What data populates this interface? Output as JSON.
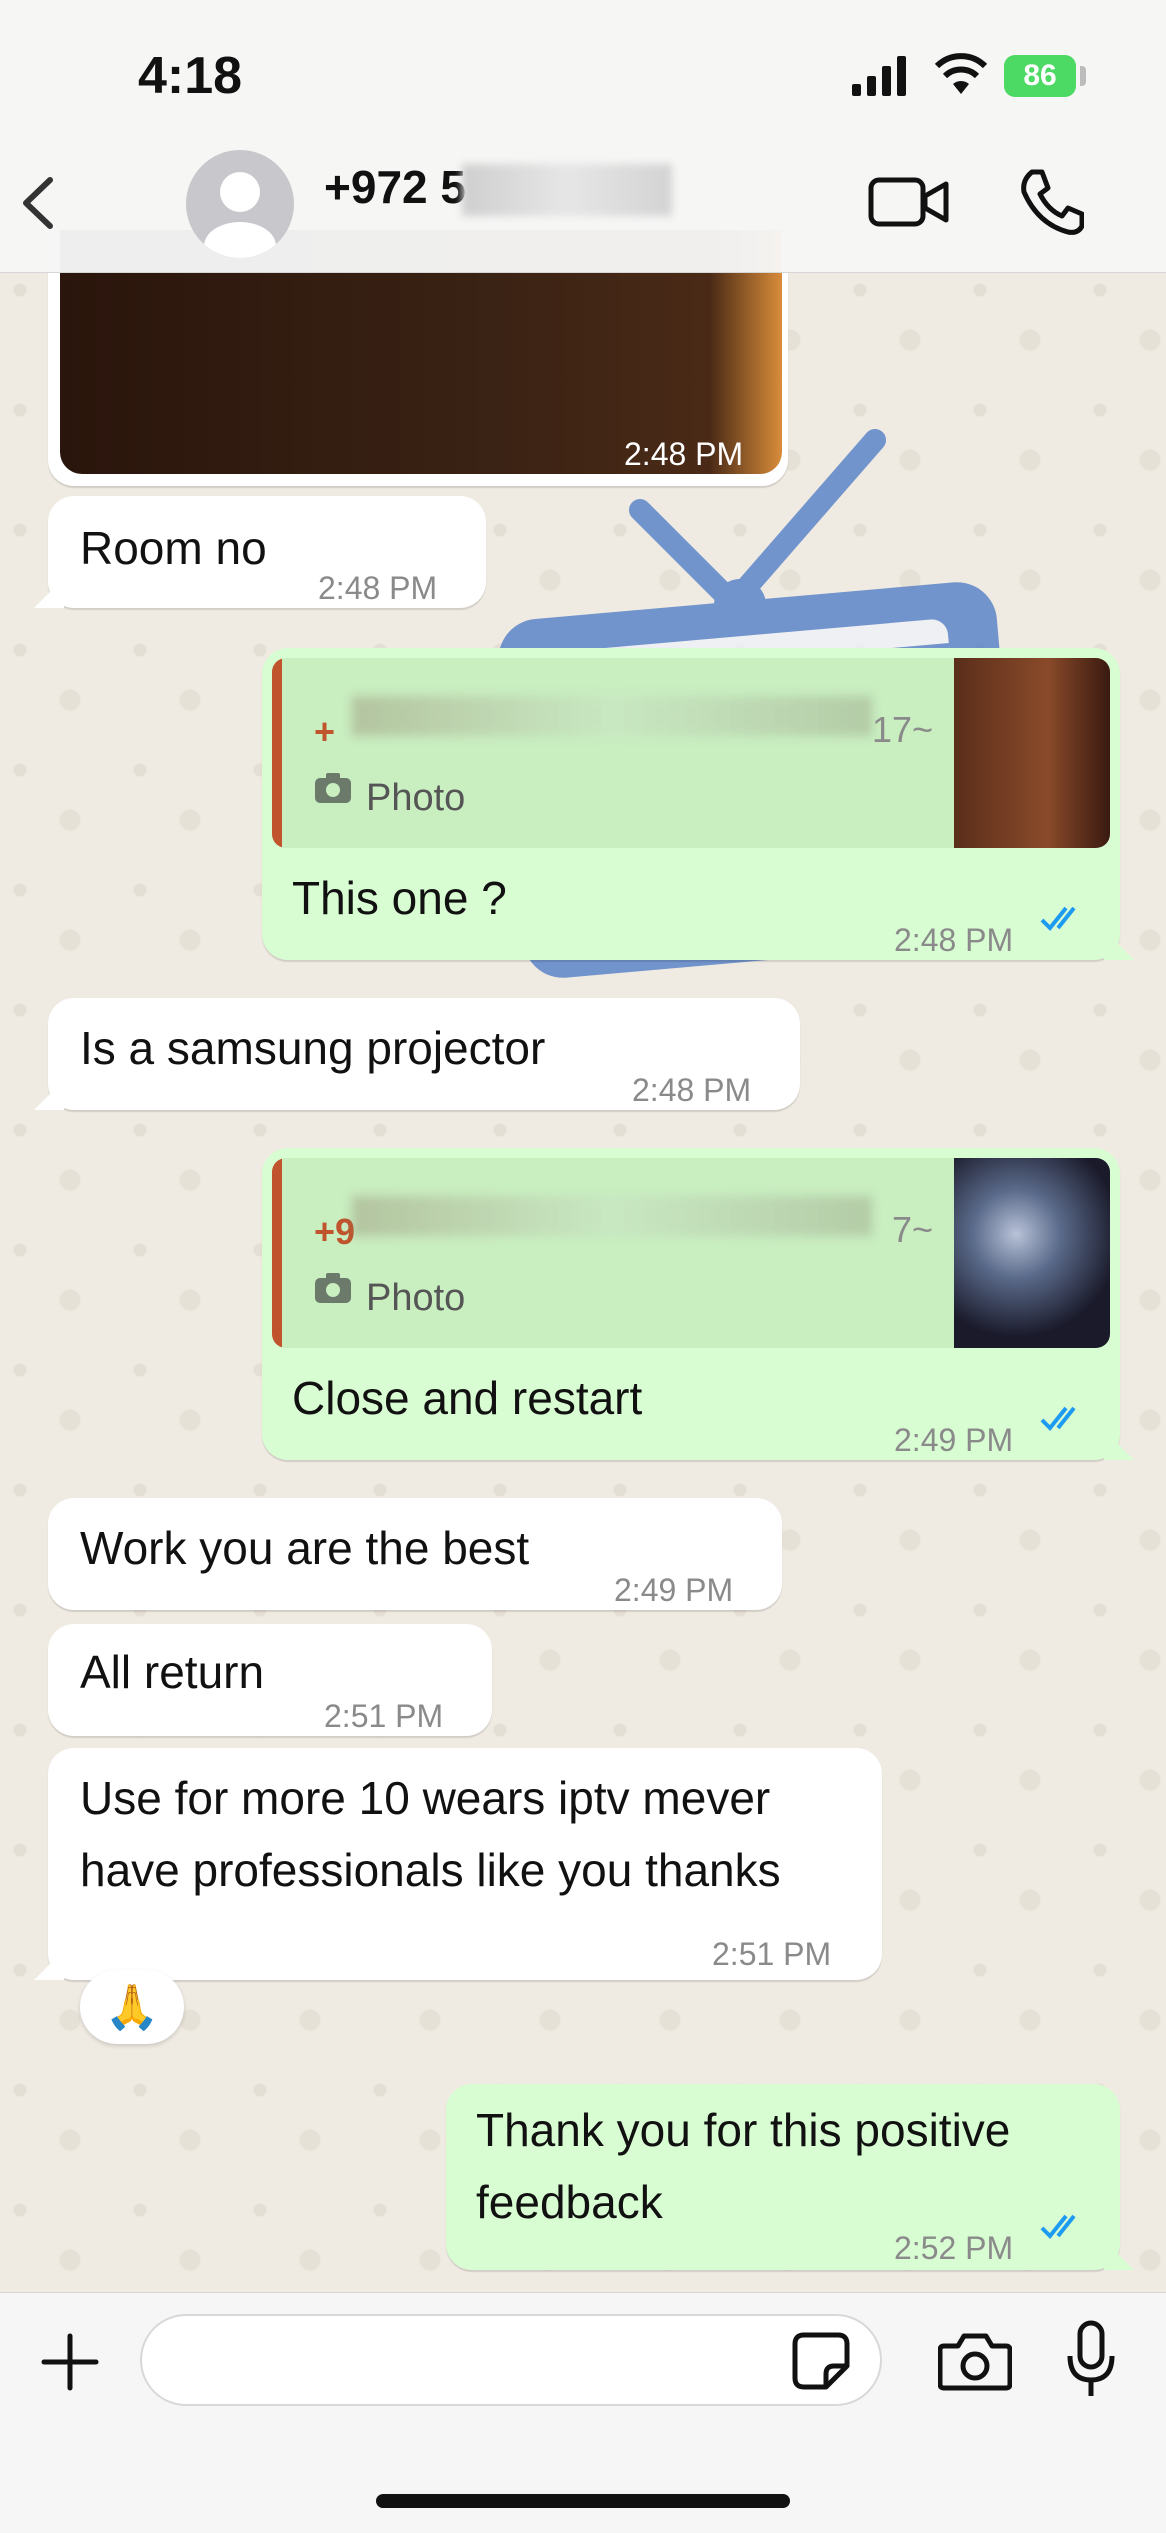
{
  "status_bar": {
    "time": "4:18",
    "battery": "86"
  },
  "header": {
    "contact_name": "+972 5"
  },
  "messages": [
    {
      "id": "m0",
      "kind": "photo",
      "time": "2:48 PM"
    },
    {
      "id": "m1",
      "kind": "in",
      "text": "Room no",
      "time": "2:48 PM"
    },
    {
      "id": "m2",
      "kind": "out_reply",
      "quote_sender": "+",
      "quote_suffix": "17~",
      "quote_type": "Photo",
      "text": "This one ?",
      "time": "2:48 PM"
    },
    {
      "id": "m3",
      "kind": "in",
      "text": "Is a samsung projector",
      "time": "2:48 PM"
    },
    {
      "id": "m4",
      "kind": "out_reply",
      "quote_sender": "+9",
      "quote_suffix": "7~",
      "quote_type": "Photo",
      "text": "Close and restart",
      "time": "2:49 PM"
    },
    {
      "id": "m5",
      "kind": "in",
      "text": "Work you are the best",
      "time": "2:49 PM"
    },
    {
      "id": "m6",
      "kind": "in",
      "text": "All return",
      "time": "2:51 PM"
    },
    {
      "id": "m7",
      "kind": "in",
      "text_line1": "Use for more 10 wears iptv mever",
      "text_line2": "have professionals like you thanks",
      "time": "2:51 PM",
      "reaction": "🙏"
    },
    {
      "id": "m8",
      "kind": "out",
      "text_line1": "Thank you for this positive",
      "text_line2": "feedback",
      "time": "2:52 PM"
    }
  ],
  "colors": {
    "incoming_bubble": "#ffffff",
    "outgoing_bubble": "#d9fdd3",
    "read_ticks": "#1d9bf0",
    "quote_accent": "#c0542c",
    "battery": "#4cd964"
  },
  "icons": [
    "back-icon",
    "avatar-icon",
    "video-call-icon",
    "voice-call-icon",
    "camera-small-icon",
    "double-check-icon",
    "plus-icon",
    "sticker-icon",
    "camera-icon",
    "microphone-icon"
  ]
}
